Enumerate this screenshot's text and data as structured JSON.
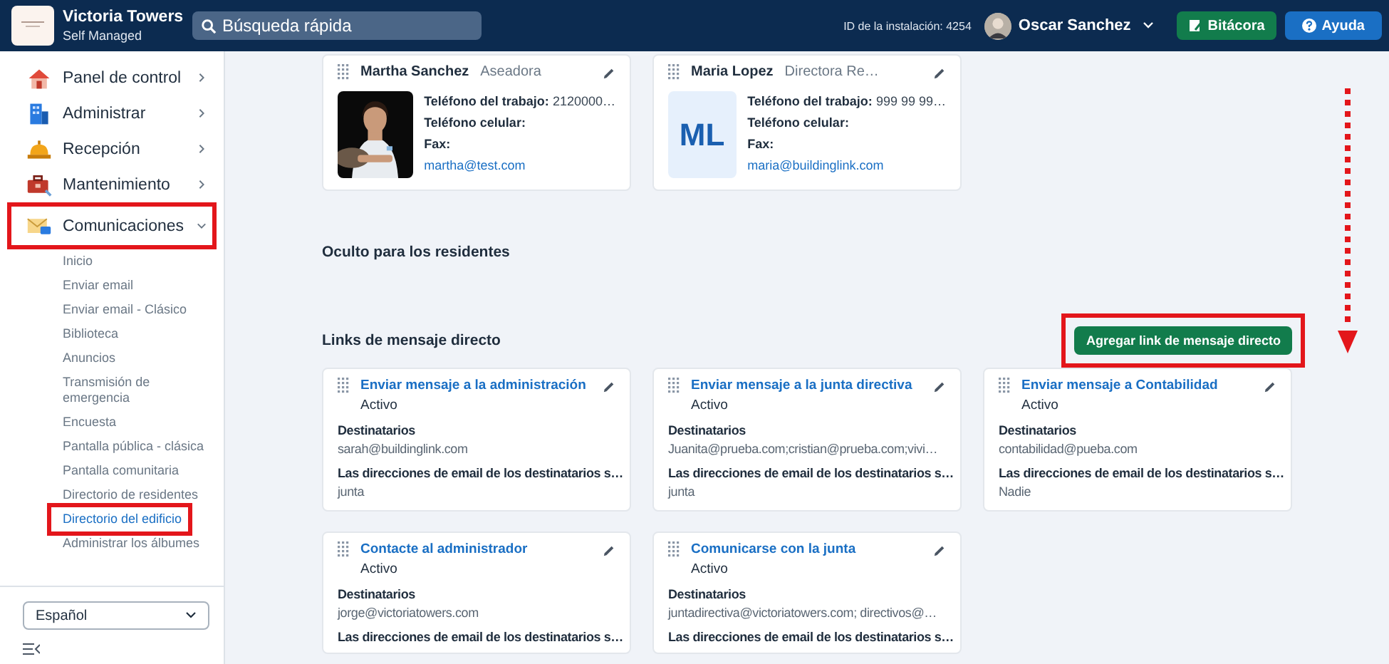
{
  "header": {
    "title": "Victoria Towers",
    "subtitle": "Self Managed",
    "search": {
      "placeholder": "Búsqueda rápida"
    },
    "installation_id": "ID de la instalación: 4254",
    "user": "Oscar Sanchez",
    "buttons": [
      {
        "label": "Bitácora",
        "kind": "log"
      },
      {
        "label": "Ayuda",
        "kind": "help"
      }
    ]
  },
  "sidebar": {
    "items": [
      {
        "label": "Panel de control",
        "kind": "dashboard",
        "expanded": false,
        "highlighted": false
      },
      {
        "label": "Administrar",
        "kind": "admin",
        "expanded": false,
        "highlighted": false
      },
      {
        "label": "Recepción",
        "kind": "frontdesk",
        "expanded": false,
        "highlighted": false
      },
      {
        "label": "Mantenimiento",
        "kind": "maintenance",
        "expanded": false,
        "highlighted": false
      },
      {
        "label": "Comunicaciones",
        "kind": "communications",
        "expanded": true,
        "highlighted": true,
        "children": [
          {
            "label": "Inicio",
            "selected": false,
            "highlighted": false
          },
          {
            "label": "Enviar email",
            "selected": false,
            "highlighted": false
          },
          {
            "label": "Enviar email - Clásico",
            "selected": false,
            "highlighted": false
          },
          {
            "label": "Biblioteca",
            "selected": false,
            "highlighted": false
          },
          {
            "label": "Anuncios",
            "selected": false,
            "highlighted": false
          },
          {
            "label": "Transmisión de emergencia",
            "selected": false,
            "highlighted": false
          },
          {
            "label": "Encuesta",
            "selected": false,
            "highlighted": false
          },
          {
            "label": "Pantalla pública - clásica",
            "selected": false,
            "highlighted": false
          },
          {
            "label": "Pantalla comunitaria",
            "selected": false,
            "highlighted": false
          },
          {
            "label": "Directorio de residentes",
            "selected": false,
            "highlighted": false
          },
          {
            "label": "Directorio del edificio",
            "selected": true,
            "highlighted": true
          },
          {
            "label": "Administrar los álbumes",
            "selected": false,
            "highlighted": false
          }
        ]
      }
    ],
    "language": "Español"
  },
  "contacts": [
    {
      "name": "Martha Sanchez",
      "role": "Aseadora",
      "work_phone_label": "Teléfono del trabajo:",
      "work_phone": "2120000…",
      "mobile_label": "Teléfono celular:",
      "fax_label": "Fax:",
      "email": "martha@test.com"
    },
    {
      "name": "Maria Lopez",
      "role": "Directora Re…",
      "avatar": {
        "kind": "initials",
        "text": "ML"
      },
      "work_phone_label": "Teléfono del trabajo:",
      "work_phone": "999 99 99…",
      "mobile_label": "Teléfono celular:",
      "fax_label": "Fax:",
      "email": "maria@buildinglink.com"
    }
  ],
  "hidden_heading": "Oculto para los residentes",
  "links_heading": "Links de mensaje directo",
  "add_button": {
    "label": "Agregar link de mensaje directo",
    "highlighted": true
  },
  "scroll_arrow": true,
  "links": [
    {
      "title": "Enviar mensaje a la administración",
      "status": "Activo",
      "recipients_label": "Destinatarios",
      "recipients": "sarah@buildinglink.com",
      "note_label": "Las direcciones de email de los destinatarios s…",
      "note": "junta"
    },
    {
      "title": "Enviar mensaje a la junta directiva",
      "status": "Activo",
      "recipients_label": "Destinatarios",
      "recipients": "Juanita@prueba.com;cristian@prueba.com;vivi…",
      "note_label": "Las direcciones de email de los destinatarios s…",
      "note": "junta"
    },
    {
      "title": "Enviar mensaje a Contabilidad",
      "status": "Activo",
      "recipients_label": "Destinatarios",
      "recipients": "contabilidad@pueba.com",
      "note_label": "Las direcciones de email de los destinatarios s…",
      "note": "Nadie"
    },
    {
      "title": "Contacte al administrador",
      "status": "Activo",
      "recipients_label": "Destinatarios",
      "recipients": "jorge@victoriatowers.com",
      "note_label": "Las direcciones de email de los destinatarios s…"
    },
    {
      "title": "Comunicarse con la junta",
      "status": "Activo",
      "recipients_label": "Destinatarios",
      "recipients": "juntadirectiva@victoriatowers.com; directivos@…",
      "note_label": "Las direcciones de email de los destinatarios s…"
    }
  ]
}
